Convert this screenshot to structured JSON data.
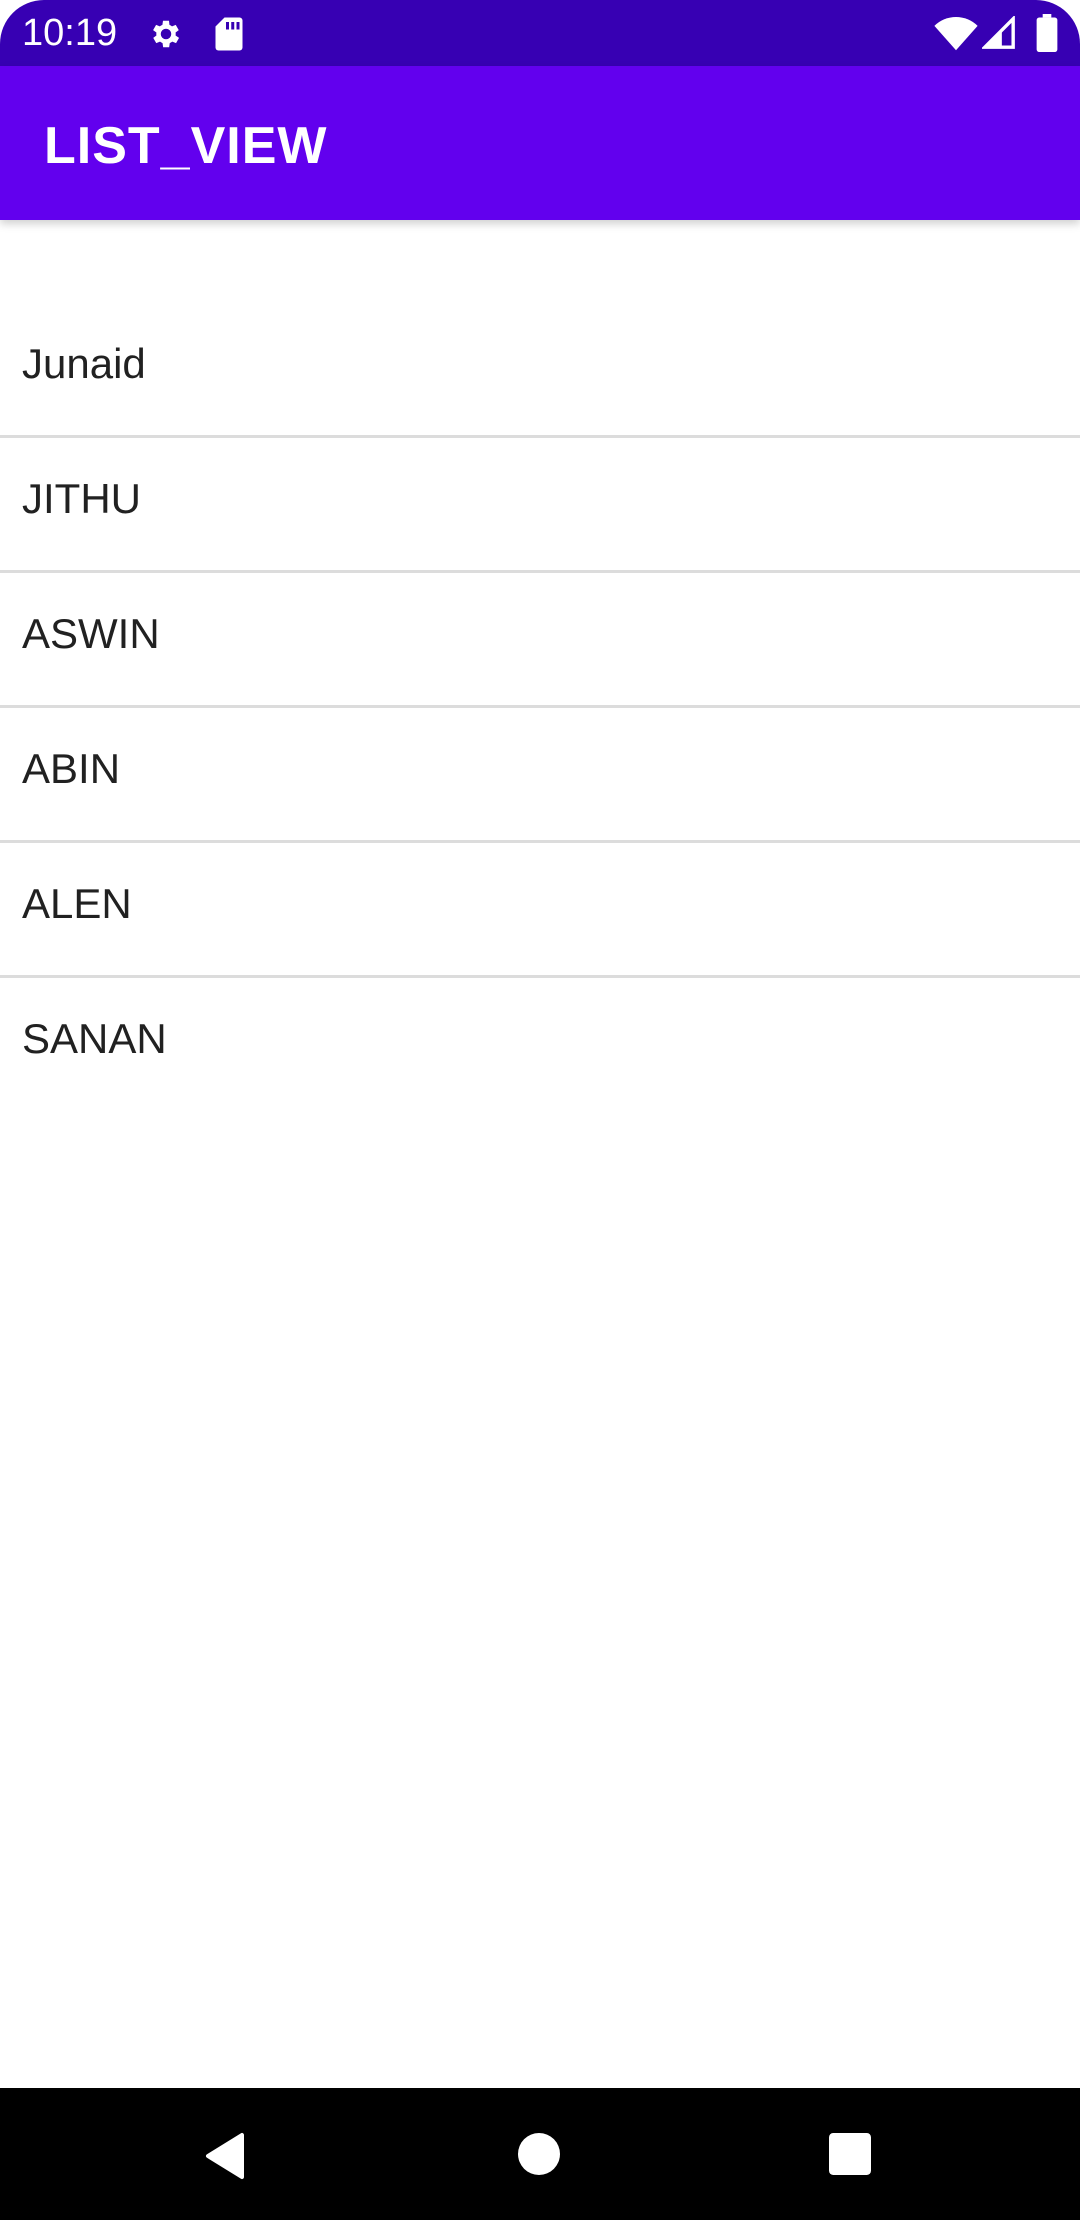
{
  "status_bar": {
    "time": "10:19",
    "icons": [
      "settings-gear-icon",
      "sd-card-icon",
      "wifi-icon",
      "cell-signal-icon",
      "battery-icon"
    ],
    "background_color": "#3700b3"
  },
  "app_bar": {
    "title": "LIST_VIEW",
    "background_color": "#6200ee"
  },
  "list": {
    "items": [
      {
        "label": "Junaid"
      },
      {
        "label": "JITHU"
      },
      {
        "label": "ASWIN"
      },
      {
        "label": "ABIN"
      },
      {
        "label": "ALEN"
      },
      {
        "label": "SANAN"
      }
    ]
  },
  "nav_bar": {
    "buttons": [
      "back-icon",
      "home-icon",
      "recents-icon"
    ]
  }
}
